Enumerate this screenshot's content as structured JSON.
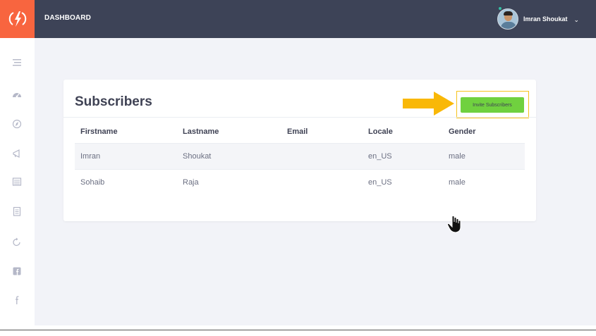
{
  "header": {
    "title": "DASHBOARD",
    "user_name": "Imran Shoukat",
    "user_menu_chevron": "⌄"
  },
  "sidebar": {
    "icons": [
      "menu-icon",
      "dashboard-icon",
      "compass-icon",
      "megaphone-icon",
      "list-icon",
      "clipboard-icon",
      "refresh-icon",
      "facebook-square-icon",
      "facebook-icon"
    ]
  },
  "card": {
    "title": "Subscribers",
    "invite_button_label": "Invite Subscribers"
  },
  "table": {
    "columns": [
      "Firstname",
      "Lastname",
      "Email",
      "Locale",
      "Gender"
    ],
    "rows": [
      [
        "Imran",
        "Shoukat",
        "",
        "en_US",
        "male"
      ],
      [
        "Sohaib",
        "Raja",
        "",
        "en_US",
        "male"
      ]
    ]
  },
  "colors": {
    "topbar": "#3d4357",
    "logo": "#f8653f",
    "invite_button": "#70d13f",
    "highlight": "#f6c21b"
  }
}
